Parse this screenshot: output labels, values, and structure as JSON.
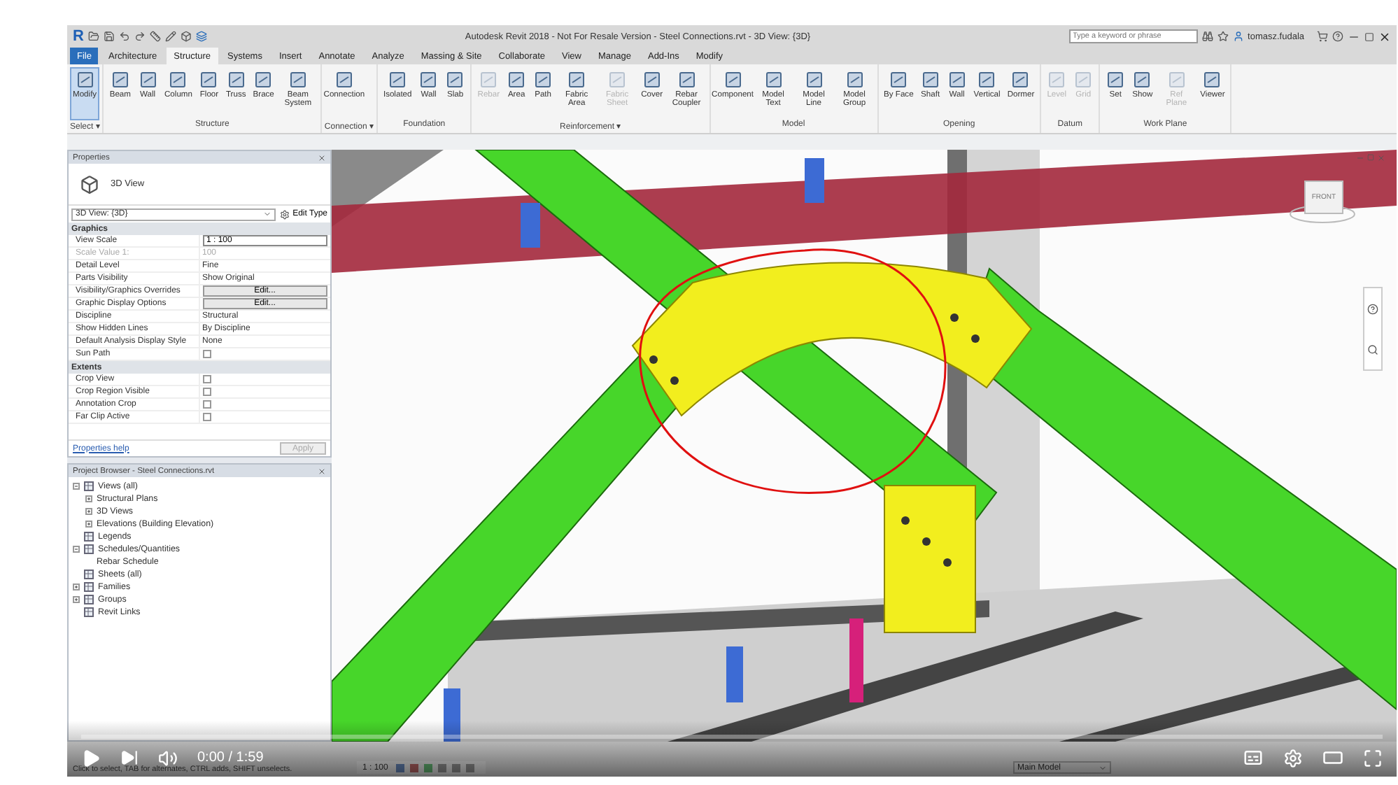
{
  "title_bar": {
    "logo": "R",
    "title": "Autodesk Revit 2018 - Not For Resale Version -    Steel Connections.rvt - 3D View: {3D}",
    "search": {
      "placeholder": "Type a keyword or phrase"
    },
    "user": "tomasz.fudala"
  },
  "ribbon_tabs": [
    {
      "label": "File",
      "kind": "file",
      "selected": false
    },
    {
      "label": "Architecture",
      "kind": "tab",
      "selected": false
    },
    {
      "label": "Structure",
      "kind": "tab",
      "selected": true
    },
    {
      "label": "Systems",
      "kind": "tab",
      "selected": false
    },
    {
      "label": "Insert",
      "kind": "tab",
      "selected": false
    },
    {
      "label": "Annotate",
      "kind": "tab",
      "selected": false
    },
    {
      "label": "Analyze",
      "kind": "tab",
      "selected": false
    },
    {
      "label": "Massing & Site",
      "kind": "tab",
      "selected": false
    },
    {
      "label": "Collaborate",
      "kind": "tab",
      "selected": false
    },
    {
      "label": "View",
      "kind": "tab",
      "selected": false
    },
    {
      "label": "Manage",
      "kind": "tab",
      "selected": false
    },
    {
      "label": "Add-Ins",
      "kind": "tab",
      "selected": false
    },
    {
      "label": "Modify",
      "kind": "tab",
      "selected": false
    }
  ],
  "ribbon_panels": [
    {
      "title": "Select ▾",
      "tools": [
        {
          "label": "Modify",
          "selected": true,
          "disabled": false
        }
      ]
    },
    {
      "title": "Structure",
      "tools": [
        {
          "label": "Beam",
          "selected": false,
          "disabled": false
        },
        {
          "label": "Wall",
          "selected": false,
          "disabled": false
        },
        {
          "label": "Column",
          "selected": false,
          "disabled": false
        },
        {
          "label": "Floor",
          "selected": false,
          "disabled": false
        },
        {
          "label": "Truss",
          "selected": false,
          "disabled": false
        },
        {
          "label": "Brace",
          "selected": false,
          "disabled": false
        },
        {
          "label": "Beam System",
          "selected": false,
          "disabled": false
        }
      ]
    },
    {
      "title": "Connection ▾",
      "tools": [
        {
          "label": "Connection",
          "selected": false,
          "disabled": false
        }
      ]
    },
    {
      "title": "Foundation",
      "tools": [
        {
          "label": "Isolated",
          "selected": false,
          "disabled": false
        },
        {
          "label": "Wall",
          "selected": false,
          "disabled": false
        },
        {
          "label": "Slab",
          "selected": false,
          "disabled": false
        }
      ]
    },
    {
      "title": "Reinforcement ▾",
      "tools": [
        {
          "label": "Rebar",
          "selected": false,
          "disabled": true
        },
        {
          "label": "Area",
          "selected": false,
          "disabled": false
        },
        {
          "label": "Path",
          "selected": false,
          "disabled": false
        },
        {
          "label": "Fabric Area",
          "selected": false,
          "disabled": false
        },
        {
          "label": "Fabric Sheet",
          "selected": false,
          "disabled": true
        },
        {
          "label": "Cover",
          "selected": false,
          "disabled": false
        },
        {
          "label": "Rebar Coupler",
          "selected": false,
          "disabled": false
        }
      ]
    },
    {
      "title": "Model",
      "tools": [
        {
          "label": "Component",
          "selected": false,
          "disabled": false
        },
        {
          "label": "Model Text",
          "selected": false,
          "disabled": false
        },
        {
          "label": "Model Line",
          "selected": false,
          "disabled": false
        },
        {
          "label": "Model Group",
          "selected": false,
          "disabled": false
        }
      ]
    },
    {
      "title": "Opening",
      "tools": [
        {
          "label": "By Face",
          "selected": false,
          "disabled": false
        },
        {
          "label": "Shaft",
          "selected": false,
          "disabled": false
        },
        {
          "label": "Wall",
          "selected": false,
          "disabled": false
        },
        {
          "label": "Vertical",
          "selected": false,
          "disabled": false
        },
        {
          "label": "Dormer",
          "selected": false,
          "disabled": false
        }
      ]
    },
    {
      "title": "Datum",
      "tools": [
        {
          "label": "Level",
          "selected": false,
          "disabled": true
        },
        {
          "label": "Grid",
          "selected": false,
          "disabled": true
        }
      ]
    },
    {
      "title": "Work Plane",
      "tools": [
        {
          "label": "Set",
          "selected": false,
          "disabled": false
        },
        {
          "label": "Show",
          "selected": false,
          "disabled": false
        },
        {
          "label": "Ref Plane",
          "selected": false,
          "disabled": true
        },
        {
          "label": "Viewer",
          "selected": false,
          "disabled": false
        }
      ]
    }
  ],
  "properties": {
    "title": "Properties",
    "type_name": "3D View",
    "instance": "3D View: {3D}",
    "edit_type": "Edit Type",
    "sections": [
      {
        "title": "Graphics",
        "rows": [
          {
            "name": "View Scale",
            "value": "1 : 100",
            "kind": "input",
            "disabled": false
          },
          {
            "name": "Scale Value    1:",
            "value": "100",
            "kind": "text",
            "disabled": true
          },
          {
            "name": "Detail Level",
            "value": "Fine",
            "kind": "text",
            "disabled": false
          },
          {
            "name": "Parts Visibility",
            "value": "Show Original",
            "kind": "text",
            "disabled": false
          },
          {
            "name": "Visibility/Graphics Overrides",
            "value": "Edit...",
            "kind": "button",
            "disabled": false
          },
          {
            "name": "Graphic Display Options",
            "value": "Edit...",
            "kind": "button",
            "disabled": false
          },
          {
            "name": "Discipline",
            "value": "Structural",
            "kind": "text",
            "disabled": false
          },
          {
            "name": "Show Hidden Lines",
            "value": "By Discipline",
            "kind": "text",
            "disabled": false
          },
          {
            "name": "Default Analysis Display Style",
            "value": "None",
            "kind": "text",
            "disabled": false
          },
          {
            "name": "Sun Path",
            "kind": "checkbox",
            "checked": false,
            "disabled": false
          }
        ]
      },
      {
        "title": "Extents",
        "rows": [
          {
            "name": "Crop View",
            "kind": "checkbox",
            "checked": false,
            "disabled": false
          },
          {
            "name": "Crop Region Visible",
            "kind": "checkbox",
            "checked": false,
            "disabled": false
          },
          {
            "name": "Annotation Crop",
            "kind": "checkbox",
            "checked": false,
            "disabled": false
          },
          {
            "name": "Far Clip Active",
            "kind": "checkbox",
            "checked": false,
            "disabled": false
          }
        ]
      }
    ],
    "help_link": "Properties help",
    "apply": {
      "label": "Apply",
      "disabled": true
    }
  },
  "project_browser": {
    "title": "Project Browser - Steel Connections.rvt",
    "items": [
      {
        "label": "Views (all)",
        "expanded": true,
        "children": [
          {
            "label": "Structural Plans",
            "expanded": false
          },
          {
            "label": "3D Views",
            "expanded": false
          },
          {
            "label": "Elevations (Building Elevation)",
            "expanded": false
          }
        ]
      },
      {
        "label": "Legends"
      },
      {
        "label": "Schedules/Quantities",
        "expanded": true,
        "children": [
          {
            "label": "Rebar Schedule"
          }
        ]
      },
      {
        "label": "Sheets (all)"
      },
      {
        "label": "Families",
        "expanded": false
      },
      {
        "label": "Groups",
        "expanded": false
      },
      {
        "label": "Revit Links"
      }
    ]
  },
  "viewport": {
    "view_cube": {
      "face": "FRONT"
    }
  },
  "status_bar": {
    "message": "Click to select, TAB for alternates, CTRL adds, SHIFT unselects.",
    "scale": "1 : 100",
    "model": "Main Model"
  },
  "player": {
    "level": 0,
    "time": "0:00 / 1:59"
  }
}
